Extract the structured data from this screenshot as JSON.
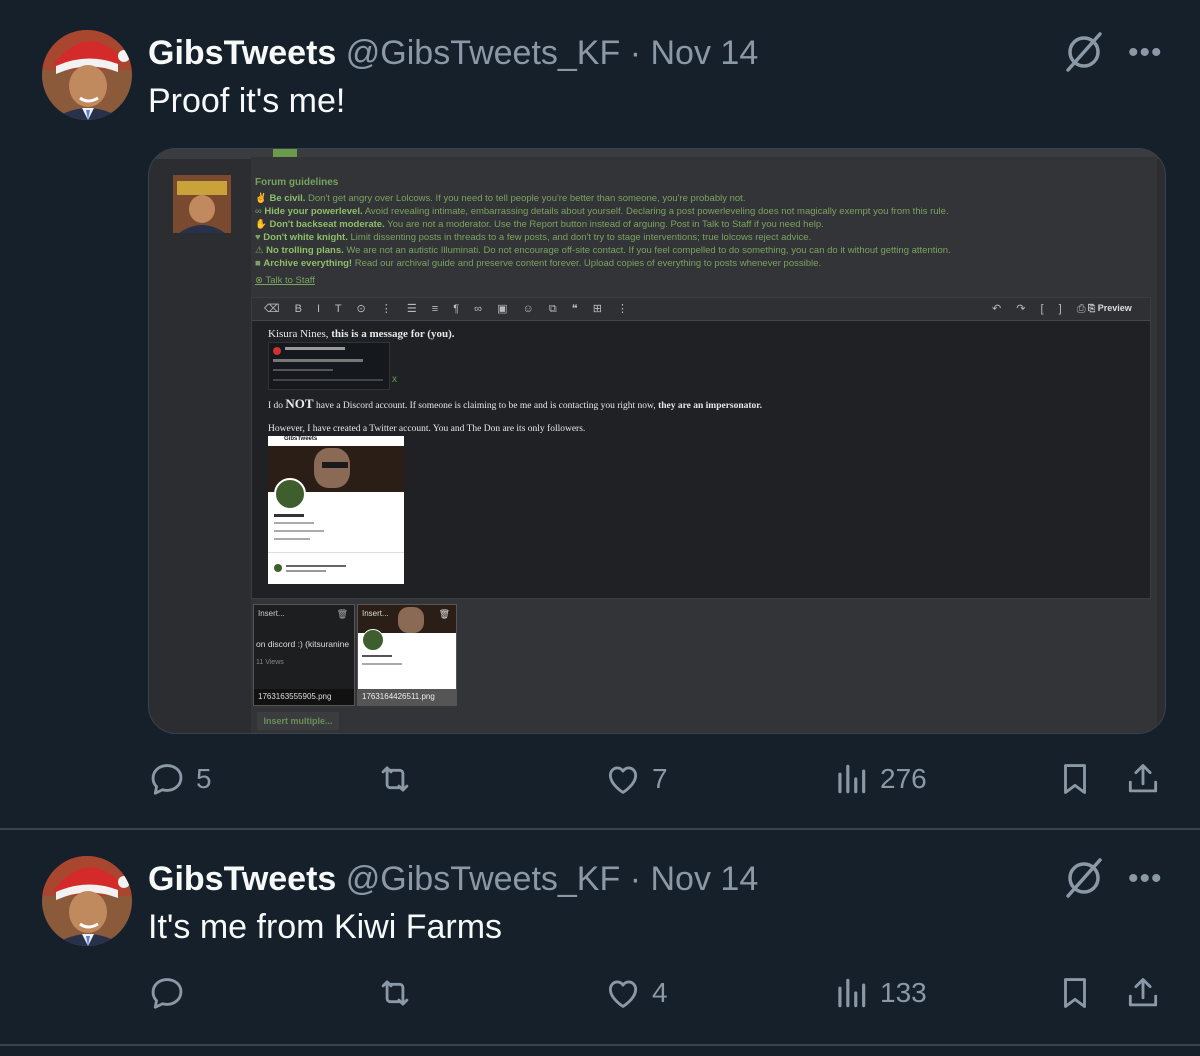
{
  "tweets": [
    {
      "name": "GibsTweets",
      "handle": "@GibsTweets_KF",
      "separator": "·",
      "date": "Nov 14",
      "text": "Proof it's me!",
      "replies": "5",
      "retweets": "",
      "likes": "7",
      "views": "276"
    },
    {
      "name": "GibsTweets",
      "handle": "@GibsTweets_KF",
      "separator": "·",
      "date": "Nov 14",
      "text": "It's me from Kiwi Farms",
      "replies": "",
      "retweets": "",
      "likes": "4",
      "views": "133"
    }
  ],
  "more_label": "•••",
  "media": {
    "guidelines_title": "Forum guidelines",
    "guidelines": [
      {
        "bold": "Be civil.",
        "text": " Don't get angry over Lolcows. If you need to tell people you're better than someone, you're probably not."
      },
      {
        "bold": "Hide your powerlevel.",
        "text": " Avoid revealing intimate, embarrassing details about yourself. Declaring a post powerleveling does not magically exempt you from this rule."
      },
      {
        "bold": "Don't backseat moderate.",
        "text": " You are not a moderator. Use the Report button instead of arguing. Post in Talk to Staff if you need help."
      },
      {
        "bold": "Don't white knight.",
        "text": " Limit dissenting posts in threads to a few posts, and don't try to stage interventions; true lolcows reject advice."
      },
      {
        "bold": "No trolling plans.",
        "text": " We are not an autistic Illuminati. Do not encourage off-site contact. If you feel compelled to do something, you can do it without getting attention."
      },
      {
        "bold": "Archive everything!",
        "text": " Read our archival guide and preserve content forever. Upload copies of everything to posts whenever possible."
      }
    ],
    "talk_to_staff": "Talk to Staff",
    "preview_label": "Preview",
    "line1_a": "Kisura Nines, ",
    "line1_b": "this is a message for (you).",
    "line2_a": "I do ",
    "line2_not": "NOT",
    "line2_b": " have a Discord account. If someone is claiming to be me and is contacting you right now, ",
    "line2_c": "they are an impersonator.",
    "line3": "However, I have created a Twitter account. You and The Don are its only followers.",
    "embed_title": "GibsTweets",
    "thumb1_label": "Insert...",
    "thumb1_text": "on discord :) (kitsuranine",
    "thumb1_views": "11 Views",
    "thumb1_file": "1763163555905.png",
    "thumb2_label": "Insert...",
    "thumb2_file": "1763164426511.png",
    "insert_multiple": "Insert multiple...",
    "x_mark": "x"
  }
}
